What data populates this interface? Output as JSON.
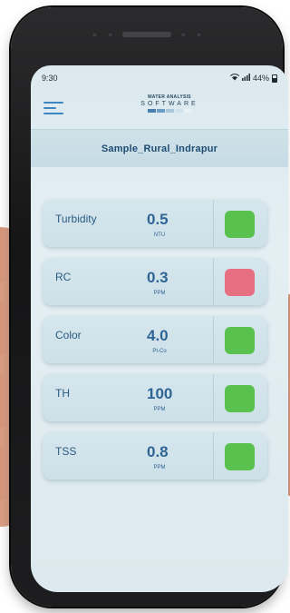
{
  "status_bar": {
    "time": "9:30",
    "battery": "44%"
  },
  "app": {
    "logo_line1": "WATER ANALYSIS",
    "logo_line2": "SOFTWARE",
    "logo_colors": [
      "#4a7fae",
      "#6d9cc4",
      "#a9c6dc",
      "#d2e2ec",
      "#e9f1f5"
    ]
  },
  "sample": {
    "name": "Sample_Rural_Indrapur"
  },
  "parameters": [
    {
      "name": "Turbidity",
      "value": "0.5",
      "unit": "NTU",
      "status_color": "#59c24f"
    },
    {
      "name": "RC",
      "value": "0.3",
      "unit": "PPM",
      "status_color": "#e66f82"
    },
    {
      "name": "Color",
      "value": "4.0",
      "unit": "Pt-Co",
      "status_color": "#59c24f"
    },
    {
      "name": "TH",
      "value": "100",
      "unit": "PPM",
      "status_color": "#59c24f"
    },
    {
      "name": "TSS",
      "value": "0.8",
      "unit": "PPM",
      "status_color": "#59c24f"
    }
  ],
  "icons": {
    "menu": "hamburger-menu-icon",
    "wifi": "wifi-icon",
    "signal": "signal-icon",
    "battery": "battery-icon"
  }
}
